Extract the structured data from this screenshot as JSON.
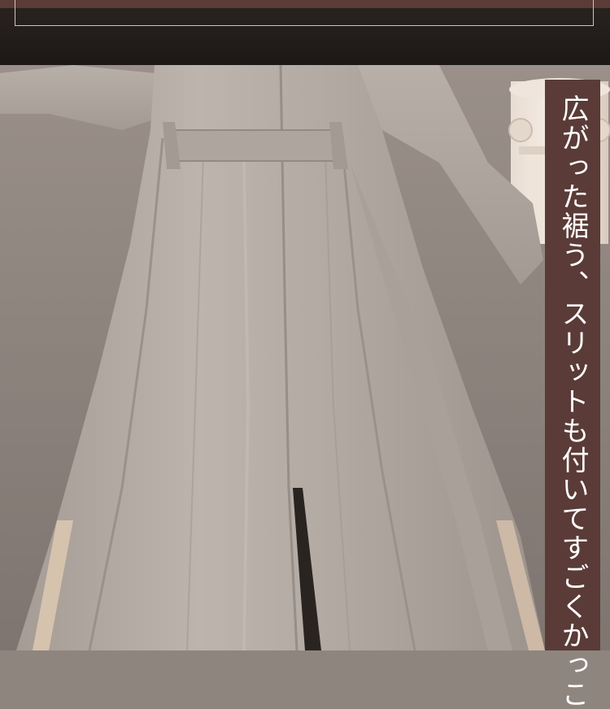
{
  "caption": {
    "text": "広がった裾う、スリットも付いてすごくかっこ"
  },
  "colors": {
    "header_background": "#1c1816",
    "header_accent": "#5a3b37",
    "frame_line": "#cfc4bd",
    "caption_panel": "#5a3b37",
    "caption_text": "#ffffff",
    "garment": "#b5aca5",
    "backdrop": "#8f857f"
  },
  "icons": {
    "column": "ornamental-column"
  }
}
